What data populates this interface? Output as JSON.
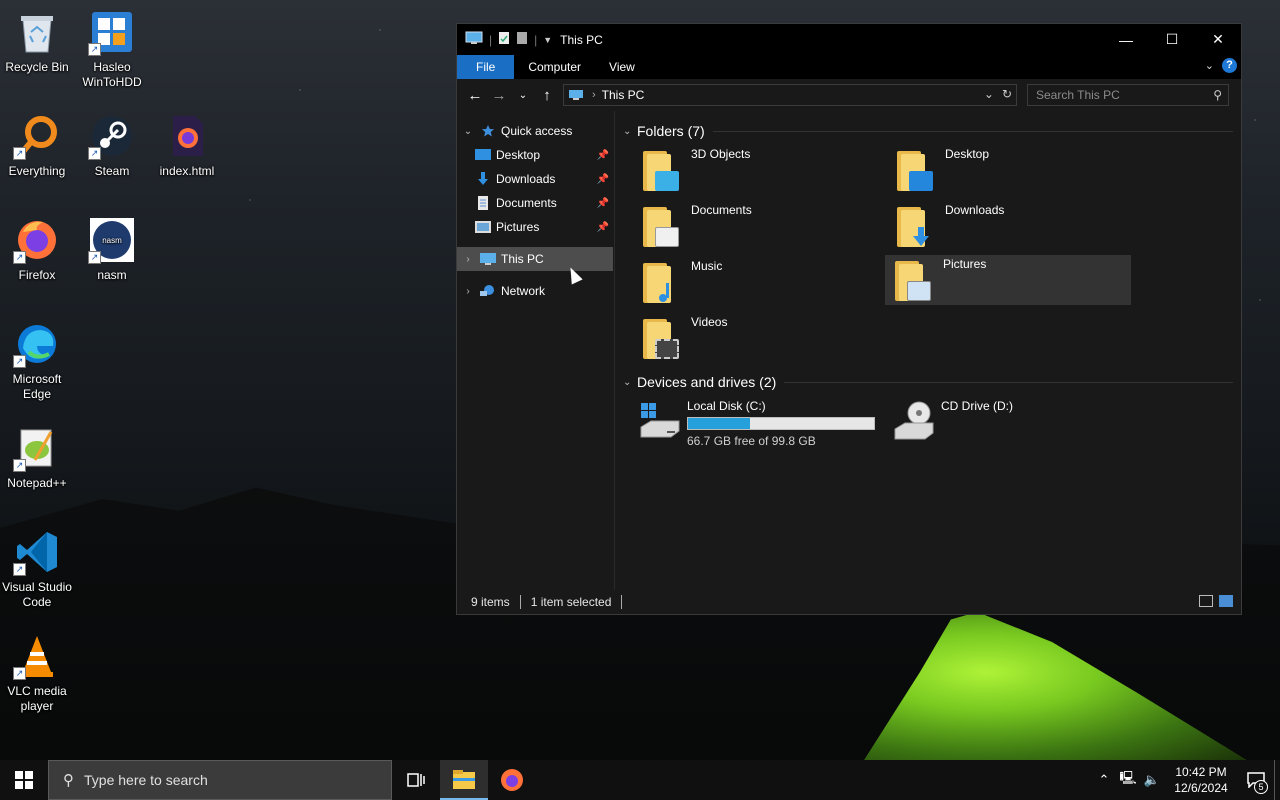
{
  "desktop": {
    "icons": [
      {
        "label": "Recycle Bin",
        "icon": "recycle-bin-icon"
      },
      {
        "label": "Hasleo WinToHDD",
        "icon": "hasleo-wintohdd-icon"
      },
      {
        "label": "Everything",
        "icon": "everything-search-icon"
      },
      {
        "label": "Steam",
        "icon": "steam-icon"
      },
      {
        "label": "index.html",
        "icon": "firefox-html-file-icon"
      },
      {
        "label": "Firefox",
        "icon": "firefox-icon"
      },
      {
        "label": "nasm",
        "icon": "nasm-icon"
      },
      {
        "label": "Microsoft Edge",
        "icon": "edge-icon"
      },
      {
        "label": "Notepad++",
        "icon": "notepad-plus-plus-icon"
      },
      {
        "label": "Visual Studio Code",
        "icon": "vscode-icon"
      },
      {
        "label": "VLC media player",
        "icon": "vlc-icon"
      }
    ]
  },
  "explorer": {
    "title": "This PC",
    "ribbon_tabs": [
      "File",
      "Computer",
      "View"
    ],
    "address": "This PC",
    "search_placeholder": "Search This PC",
    "nav": {
      "quick_access": "Quick access",
      "quick_items": [
        "Desktop",
        "Downloads",
        "Documents",
        "Pictures"
      ],
      "this_pc": "This PC",
      "network": "Network"
    },
    "folders_header": "Folders (7)",
    "folders": [
      "3D Objects",
      "Desktop",
      "Documents",
      "Downloads",
      "Music",
      "Pictures",
      "Videos"
    ],
    "drives_header": "Devices and drives (2)",
    "drives": [
      {
        "name": "Local Disk (C:)",
        "free_text": "66.7 GB free of 99.8 GB",
        "used_fraction": 0.332
      },
      {
        "name": "CD Drive (D:)"
      }
    ],
    "status": {
      "items": "9 items",
      "selected": "1 item selected"
    }
  },
  "taskbar": {
    "search_placeholder": "Type here to search",
    "time": "10:42 PM",
    "date": "12/6/2024",
    "notification_count": "5"
  },
  "colors": {
    "accent": "#1a6fc4",
    "drive_fill": "#26a0da",
    "folder_yellow": "#f7d675"
  }
}
